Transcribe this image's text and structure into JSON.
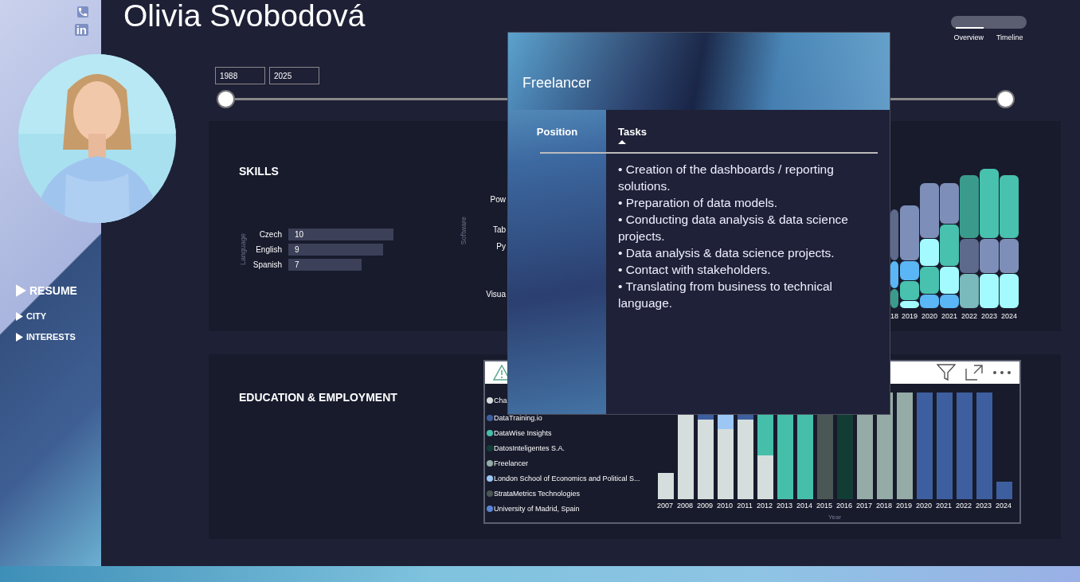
{
  "profile": {
    "name": "Olivia Svobodová",
    "linkedin": "in"
  },
  "nav": [
    {
      "label": "RESUME",
      "selected": true
    },
    {
      "label": "CITY",
      "selected": false
    },
    {
      "label": "INTERESTS",
      "selected": false
    }
  ],
  "view_toggle": [
    {
      "label": "Overview",
      "selected": true
    },
    {
      "label": "Timeline",
      "selected": false
    }
  ],
  "date_slicer": {
    "start": "1988",
    "end": "2025",
    "thumbs": [
      {
        "level": 0
      },
      {
        "level": 1
      }
    ]
  },
  "skills": {
    "title": "SKILLS",
    "language_chart": {
      "chart_data": {
        "type": "bar",
        "orientation": "horizontal",
        "ylabel": "Language",
        "categories": [
          "Czech",
          "English",
          "Spanish"
        ],
        "values": [
          10,
          9,
          7
        ],
        "data_labels": true
      }
    },
    "software_chart": {
      "axis_label": "Software",
      "labels": [
        "Pow",
        "Tab",
        "Py",
        "Visua"
      ]
    },
    "timeline_chart": {
      "x_labels": [
        "18",
        "2019",
        "2020",
        "2021",
        "2022",
        "2023",
        "2024"
      ]
    }
  },
  "education": {
    "title": "EDUCATION & EMPLOYMENT",
    "legend": [
      {
        "label": "Cha",
        "color": "#d5dedc"
      },
      {
        "label": "DataTraining.io",
        "color": "#3e5f9f"
      },
      {
        "label": "DataWise Insights",
        "color": "#45bfaa"
      },
      {
        "label": "DatosInteligentes S.A.",
        "color": "#123d35"
      },
      {
        "label": "Freelancer",
        "color": "#95aca6"
      },
      {
        "label": "London School of Economics and Political S...",
        "color": "#9cc7f5"
      },
      {
        "label": "StrataMetrics Technologies",
        "color": "#4b5755"
      },
      {
        "label": "University of Madrid, Spain",
        "color": "#5b84d6"
      }
    ],
    "x_labels": [
      "2007",
      "2008",
      "2009",
      "2010",
      "2011",
      "2012",
      "2013",
      "2014",
      "2015",
      "2016",
      "2017",
      "2018",
      "2019",
      "2020",
      "2021",
      "2022",
      "2023",
      "2024"
    ],
    "xlabel": "Year"
  },
  "tooltip": {
    "title": "Freelancer",
    "columns": [
      {
        "label": "Position",
        "sorted": false
      },
      {
        "label": "Tasks",
        "sorted": true
      }
    ],
    "tasks": [
      "• Creation of the dashboards / reporting solutions.",
      "• Preparation of data models.",
      "• Conducting data analysis & data science projects.",
      "• Data analysis & data science projects.",
      "• Contact with stakeholders.",
      "• Translating from business to technical language."
    ]
  }
}
